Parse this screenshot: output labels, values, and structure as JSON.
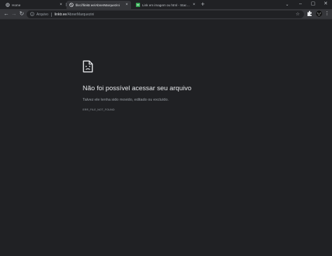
{
  "browser": {
    "tabs": [
      {
        "title": "Home",
        "favicon": "globe-icon",
        "active": false
      },
      {
        "title": "file:///linktr.ee/AbnerMarquezini",
        "favicon": "broken-file-icon",
        "active": true
      },
      {
        "title": "Link em imagem ou html - Stack O...",
        "favicon": "stackoverflow-icon",
        "active": false
      }
    ],
    "new_tab_label": "+",
    "window_controls": {
      "minimize": "–",
      "maximize": "▢",
      "close": "✕"
    }
  },
  "toolbar": {
    "back_icon": "←",
    "forward_icon": "→",
    "reload_icon": "↻",
    "omnibox": {
      "security_label": "Arquivo",
      "host": "linktr.ee",
      "path": "/AbnerMarquezini"
    },
    "bookmark_icon": "☆"
  },
  "error_page": {
    "title": "Não foi possível acessar seu arquivo",
    "description": "Talvez ele tenha sido movido, editado ou excluído.",
    "code": "ERR_FILE_NOT_FOUND"
  },
  "colors": {
    "background": "#202124",
    "toolbar": "#35363a",
    "text_primary": "#e8eaed",
    "text_secondary": "#9aa0a6"
  }
}
